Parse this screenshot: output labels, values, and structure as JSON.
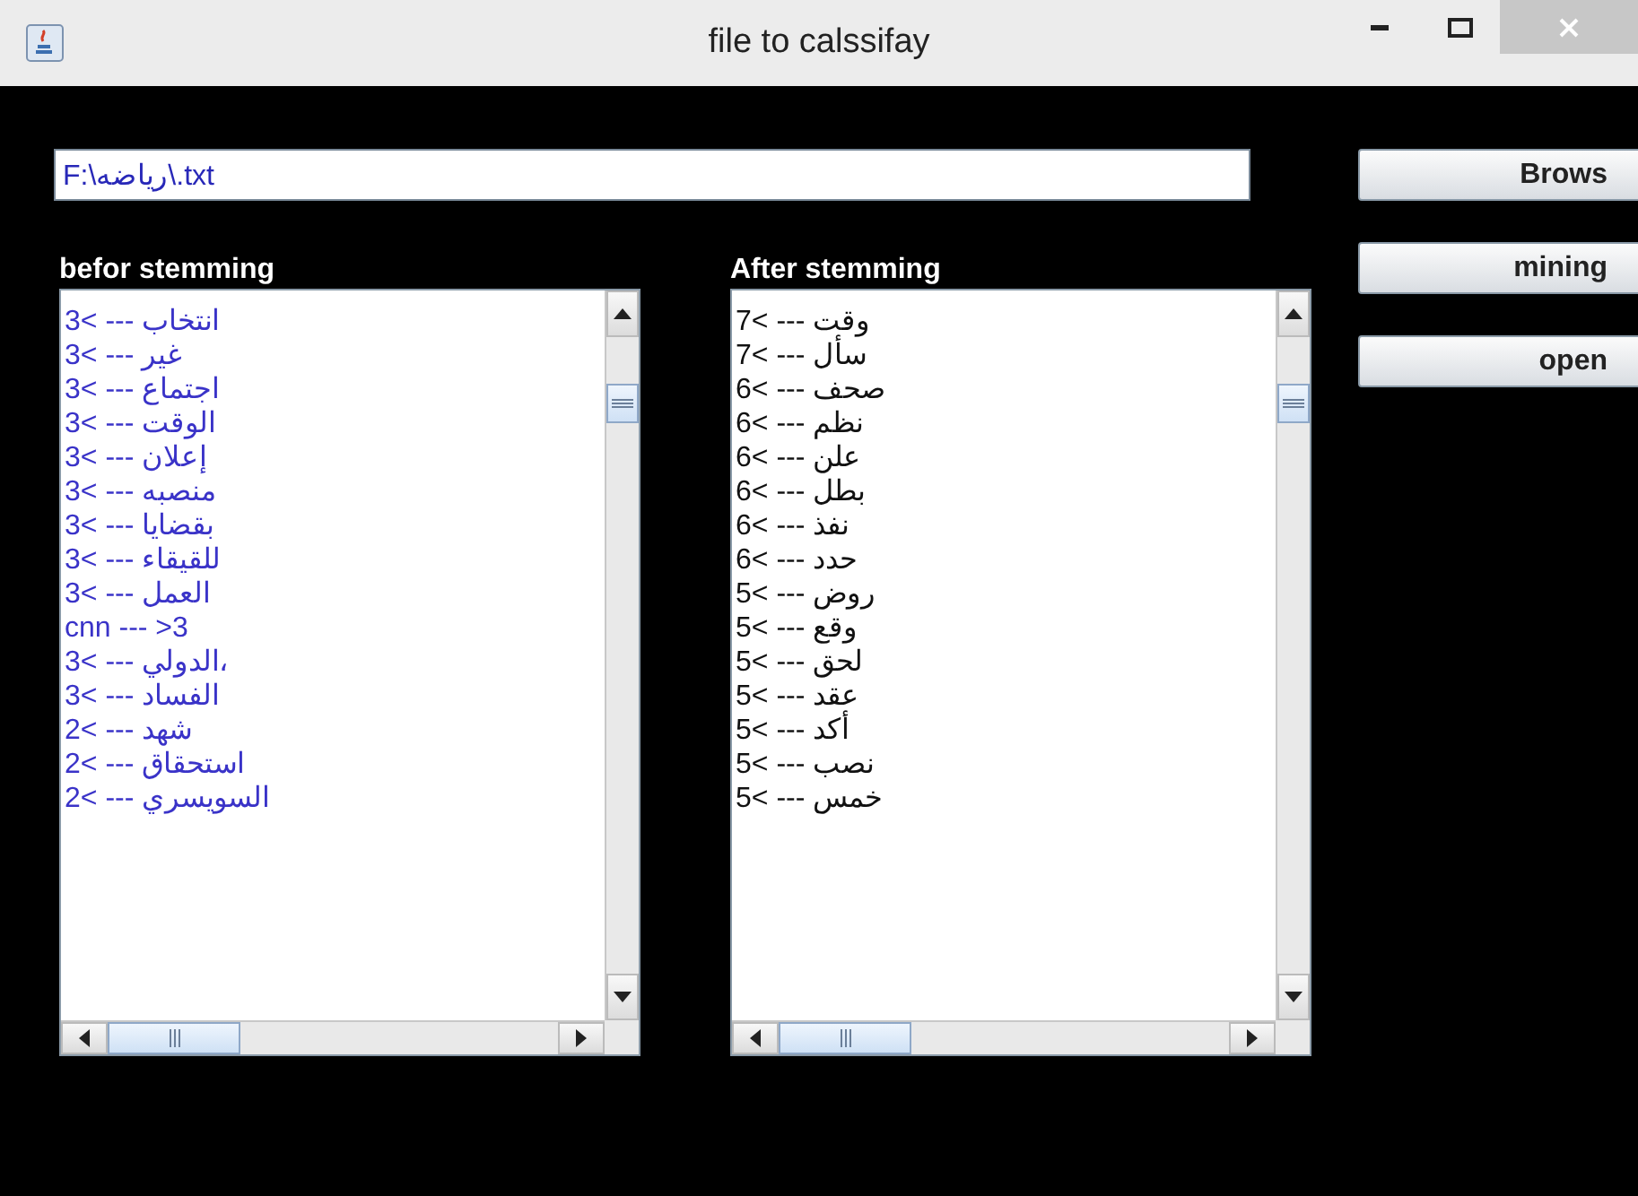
{
  "window": {
    "title": "file to calssifay"
  },
  "file_field": {
    "value": "F:\\رياضه\\.txt"
  },
  "buttons": [
    "Brows",
    "mining",
    "open"
  ],
  "before_stemming": {
    "label": "befor stemming",
    "kind": "raw",
    "rows": [
      "3< --- انتخاب",
      "3< --- غير",
      "3< --- اجتماع",
      "3< --- الوقت",
      "3< --- إعلان",
      "3< --- منصبه",
      "3< --- بقضايا",
      "3< --- للقيقاء",
      "3< --- العمل",
      "cnn --- >3",
      "3< --- الدولي،",
      "3< --- الفساد",
      "2< --- شهد",
      "2< --- استحقاق",
      "2< --- السويسري"
    ]
  },
  "after_stemming": {
    "label": "After stemming",
    "kind": "stemmed",
    "rows": [
      "7< --- وقت",
      "7< --- سأل",
      "6< --- صحف",
      "6< --- نظم",
      "6< --- علن",
      "6< --- بطل",
      "6< --- نفذ",
      "6< --- حدد",
      "5< --- روض",
      "5< --- وقع",
      "5< --- لحق",
      "5< --- عقد",
      "5< --- أكد",
      "5< --- نصب",
      "5< --- خمس"
    ]
  }
}
